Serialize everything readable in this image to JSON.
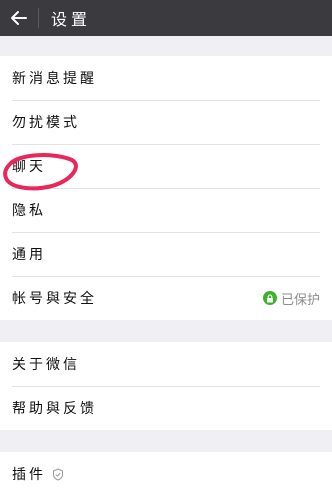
{
  "header": {
    "title": "设置",
    "back_icon": "arrow-left-icon"
  },
  "group1": {
    "items": [
      {
        "label": "新消息提醒"
      },
      {
        "label": "勿扰模式"
      },
      {
        "label": "聊天"
      },
      {
        "label": "隐私"
      },
      {
        "label": "通用"
      },
      {
        "label": "帐号與安全",
        "status": "已保护",
        "status_icon": "lock-icon",
        "status_color": "#3fb12e"
      }
    ]
  },
  "group2": {
    "items": [
      {
        "label": "关于微信"
      },
      {
        "label": "帮助與反馈"
      }
    ]
  },
  "group3": {
    "items": [
      {
        "label": "插件",
        "icon": "shield-check-icon"
      }
    ]
  },
  "annotation": {
    "color": "#e8285a",
    "shape": "hand-drawn-circle"
  }
}
